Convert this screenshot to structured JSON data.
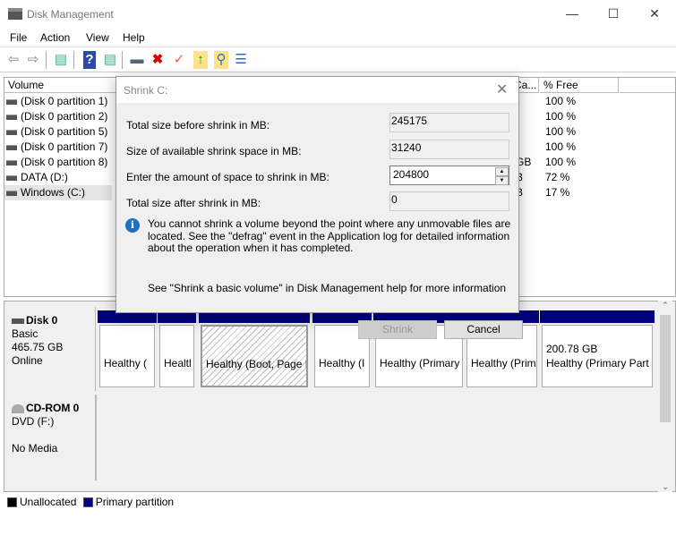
{
  "window": {
    "title": "Disk Management",
    "icon": "disk-management-icon"
  },
  "menu": [
    "File",
    "Action",
    "View",
    "Help"
  ],
  "toolbar": [
    "back-icon",
    "forward-icon",
    "show-hide-console-icon",
    "help-icon",
    "show-action-pane-icon",
    "connect-drive-icon",
    "delete-icon",
    "properties-icon",
    "folder-up-icon",
    "search-folder-icon",
    "settings-list-icon"
  ],
  "volumes": {
    "headers": {
      "volume": "Volume",
      "cap": "Ca...",
      "free": "% Free"
    },
    "rows": [
      {
        "name": "(Disk 0 partition 1)",
        "cap": "",
        "free": "100 %"
      },
      {
        "name": "(Disk 0 partition 2)",
        "cap": "",
        "free": "100 %"
      },
      {
        "name": "(Disk 0 partition 5)",
        "cap": "",
        "free": "100 %"
      },
      {
        "name": "(Disk 0 partition 7)",
        "cap": "",
        "free": "100 %"
      },
      {
        "name": "(Disk 0 partition 8)",
        "cap": "GB",
        "free": "100 %"
      },
      {
        "name": "DATA (D:)",
        "cap": "B",
        "free": "72 %"
      },
      {
        "name": "Windows (C:)",
        "cap": "B",
        "free": "17 %"
      }
    ]
  },
  "disks": [
    {
      "name": "Disk 0",
      "type": "Basic",
      "size": "465.75 GB",
      "status": "Online",
      "partitions": [
        {
          "size": "",
          "status": "Healthy ("
        },
        {
          "size": "",
          "status": "Healtl"
        },
        {
          "size": "",
          "status": "Healthy (Boot, Page F"
        },
        {
          "size": "",
          "status": "Healthy (I"
        },
        {
          "size": "",
          "status": "Healthy (Primary"
        },
        {
          "size": "",
          "status": "Healthy (Prim"
        },
        {
          "size": "200.78 GB",
          "status": "Healthy (Primary Part"
        }
      ]
    },
    {
      "name": "CD-ROM 0",
      "type": "DVD (F:)",
      "status": "No Media"
    }
  ],
  "legend": [
    {
      "label": "Unallocated",
      "color": "#000000"
    },
    {
      "label": "Primary partition",
      "color": "#000080"
    }
  ],
  "dialog": {
    "title": "Shrink C:",
    "fields": [
      {
        "label": "Total size before shrink in MB:",
        "value": "245175"
      },
      {
        "label": "Size of available shrink space in MB:",
        "value": "31240"
      },
      {
        "label": "Enter the amount of space to shrink in MB:",
        "value": "204800"
      },
      {
        "label": "Total size after shrink in MB:",
        "value": "0"
      }
    ],
    "info": "You cannot shrink a volume beyond the point where any unmovable files are located. See the \"defrag\" event in the Application log for detailed information about the operation when it has completed.",
    "help": "See \"Shrink a basic volume\" in Disk Management help for more information",
    "shrink": "Shrink",
    "cancel": "Cancel"
  }
}
